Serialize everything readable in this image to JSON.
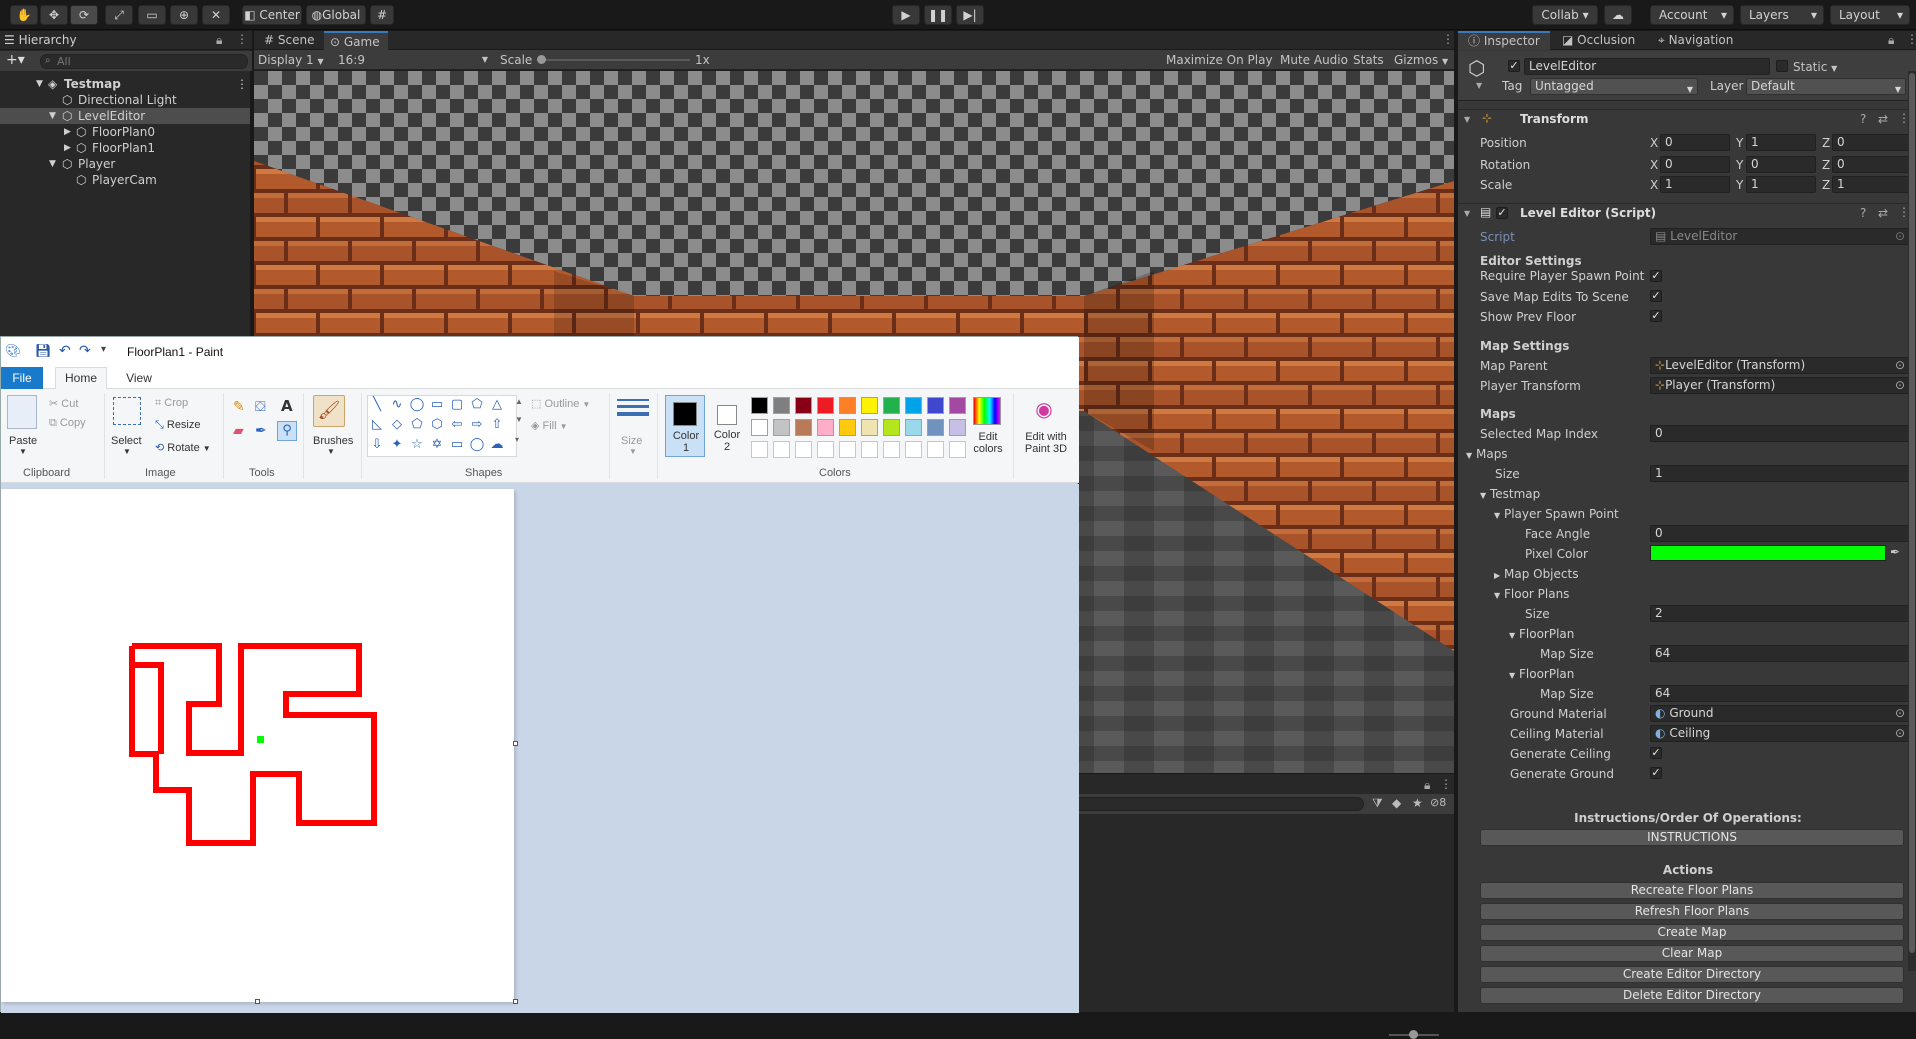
{
  "toolbar": {
    "center_label": "Center",
    "global_label": "Global",
    "collab_label": "Collab ▾",
    "account_label": "Account",
    "layers_label": "Layers",
    "layout_label": "Layout"
  },
  "hierarchy": {
    "tab": "Hierarchy",
    "search_placeholder": "All",
    "items": [
      {
        "label": "Testmap"
      },
      {
        "label": "Directional Light"
      },
      {
        "label": "LevelEditor"
      },
      {
        "label": "FloorPlan0"
      },
      {
        "label": "FloorPlan1"
      },
      {
        "label": "Player"
      },
      {
        "label": "PlayerCam"
      }
    ]
  },
  "game": {
    "tabs": [
      "Scene",
      "Game"
    ],
    "display": "Display 1",
    "aspect": "16:9",
    "scale_label": "Scale",
    "scale_value": "1x",
    "maximize": "Maximize On Play",
    "mute": "Mute Audio",
    "stats": "Stats",
    "gizmos": "Gizmos",
    "colors": {
      "brick": "#b35a2c",
      "mortar": "#6b2e18",
      "ceiling_light": "#8a8a8a",
      "ceiling_dark": "#3c3c3c"
    }
  },
  "console": {
    "count": "8"
  },
  "paint": {
    "title": "FloorPlan1 - Paint",
    "tabs": [
      "File",
      "Home",
      "View"
    ],
    "clipboard": {
      "paste": "Paste",
      "cut": "Cut",
      "copy": "Copy",
      "group": "Clipboard"
    },
    "image": {
      "select": "Select",
      "crop": "Crop",
      "resize": "Resize",
      "rotate": "Rotate",
      "group": "Image"
    },
    "tools_group": "Tools",
    "brushes": "Brushes",
    "shapes": {
      "outline": "Outline",
      "fill": "Fill",
      "group": "Shapes"
    },
    "size": "Size",
    "color1": "Color\n1",
    "color1_a": "Color",
    "color1_b": "1",
    "color2_a": "Color",
    "color2_b": "2",
    "colors_group": "Colors",
    "edit_colors_a": "Edit",
    "edit_colors_b": "colors",
    "paint3d_a": "Edit with",
    "paint3d_b": "Paint 3D",
    "palette_row1": [
      "#000000",
      "#7f7f7f",
      "#880015",
      "#ed1c24",
      "#ff7f27",
      "#fff200",
      "#22b14c",
      "#00a2e8",
      "#3f48cc",
      "#a349a4"
    ],
    "palette_row2": [
      "#ffffff",
      "#c3c3c3",
      "#b97a57",
      "#ffaec9",
      "#ffc90e",
      "#efe4b0",
      "#b5e61d",
      "#99d9ea",
      "#7092be",
      "#c8bfe7"
    ],
    "maze_color": "#ff0000",
    "spawn_color": "#00ff00"
  },
  "inspector": {
    "tabs": [
      "Inspector",
      "Occlusion",
      "Navigation"
    ],
    "object_name": "LevelEditor",
    "static_label": "Static",
    "tag_label": "Tag",
    "tag_value": "Untagged",
    "layer_label": "Layer",
    "layer_value": "Default",
    "transform": {
      "title": "Transform",
      "position": {
        "label": "Position",
        "x": "0",
        "y": "1",
        "z": "0"
      },
      "rotation": {
        "label": "Rotation",
        "x": "0",
        "y": "0",
        "z": "0"
      },
      "scale": {
        "label": "Scale",
        "x": "1",
        "y": "1",
        "z": "1"
      }
    },
    "script_component": {
      "title": "Level Editor (Script)",
      "script_label": "Script",
      "script_value": "LevelEditor",
      "editor_settings": "Editor Settings",
      "require_spawn": "Require Player Spawn Point",
      "save_edits": "Save Map Edits To Scene",
      "show_prev": "Show Prev Floor",
      "map_settings": "Map Settings",
      "map_parent_label": "Map Parent",
      "map_parent_value": "LevelEditor (Transform)",
      "player_transform_label": "Player Transform",
      "player_transform_value": "Player (Transform)",
      "maps_header": "Maps",
      "selected_index_label": "Selected Map Index",
      "selected_index_value": "0",
      "maps_label": "Maps",
      "size_label": "Size",
      "size_value": "1",
      "testmap": "Testmap",
      "spawn_point": "Player Spawn Point",
      "face_angle_label": "Face Angle",
      "face_angle_value": "0",
      "pixel_color_label": "Pixel Color",
      "pixel_color": "#00ff00",
      "map_objects": "Map Objects",
      "floor_plans": "Floor Plans",
      "fp_size_label": "Size",
      "fp_size_value": "2",
      "floorplan_a": "FloorPlan",
      "map_size_a_label": "Map Size",
      "map_size_a_value": "64",
      "floorplan_b": "FloorPlan",
      "map_size_b_label": "Map Size",
      "map_size_b_value": "64",
      "ground_material_label": "Ground Material",
      "ground_material_value": "Ground",
      "ceiling_material_label": "Ceiling Material",
      "ceiling_material_value": "Ceiling",
      "gen_ceiling": "Generate Ceiling",
      "gen_ground": "Generate Ground",
      "instructions_title": "Instructions/Order Of Operations:",
      "instructions_button": "INSTRUCTIONS",
      "actions_title": "Actions",
      "actions": [
        "Recreate Floor Plans",
        "Refresh Floor Plans",
        "Create Map",
        "Clear Map",
        "Create Editor Directory",
        "Delete Editor Directory"
      ]
    }
  }
}
